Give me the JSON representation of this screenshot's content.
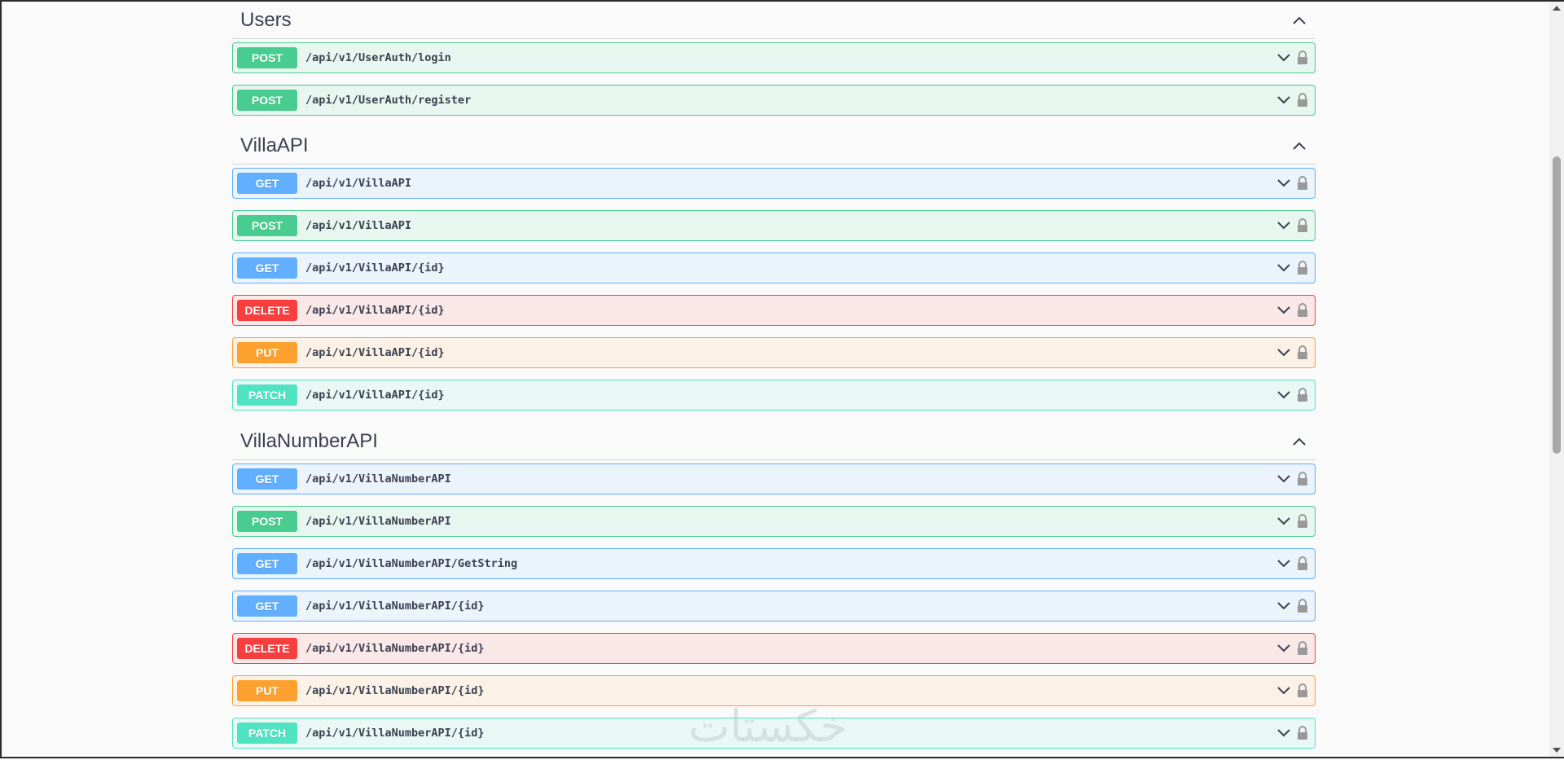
{
  "sections": [
    {
      "title": "Users",
      "operations": [
        {
          "method": "POST",
          "path": "/api/v1/UserAuth/login"
        },
        {
          "method": "POST",
          "path": "/api/v1/UserAuth/register"
        }
      ]
    },
    {
      "title": "VillaAPI",
      "operations": [
        {
          "method": "GET",
          "path": "/api/v1/VillaAPI"
        },
        {
          "method": "POST",
          "path": "/api/v1/VillaAPI"
        },
        {
          "method": "GET",
          "path": "/api/v1/VillaAPI/{id}"
        },
        {
          "method": "DELETE",
          "path": "/api/v1/VillaAPI/{id}"
        },
        {
          "method": "PUT",
          "path": "/api/v1/VillaAPI/{id}"
        },
        {
          "method": "PATCH",
          "path": "/api/v1/VillaAPI/{id}"
        }
      ]
    },
    {
      "title": "VillaNumberAPI",
      "operations": [
        {
          "method": "GET",
          "path": "/api/v1/VillaNumberAPI"
        },
        {
          "method": "POST",
          "path": "/api/v1/VillaNumberAPI"
        },
        {
          "method": "GET",
          "path": "/api/v1/VillaNumberAPI/GetString"
        },
        {
          "method": "GET",
          "path": "/api/v1/VillaNumberAPI/{id}"
        },
        {
          "method": "DELETE",
          "path": "/api/v1/VillaNumberAPI/{id}"
        },
        {
          "method": "PUT",
          "path": "/api/v1/VillaNumberAPI/{id}"
        },
        {
          "method": "PATCH",
          "path": "/api/v1/VillaNumberAPI/{id}"
        }
      ]
    }
  ],
  "watermark": "خکستات",
  "colors": {
    "get": "#61affe",
    "post": "#49cc90",
    "delete": "#f93e3e",
    "put": "#fca130",
    "patch": "#50e3c2"
  },
  "icons": {
    "section_toggle": "chevron-up-icon",
    "op_expand": "chevron-down-icon",
    "op_auth": "lock-icon"
  }
}
